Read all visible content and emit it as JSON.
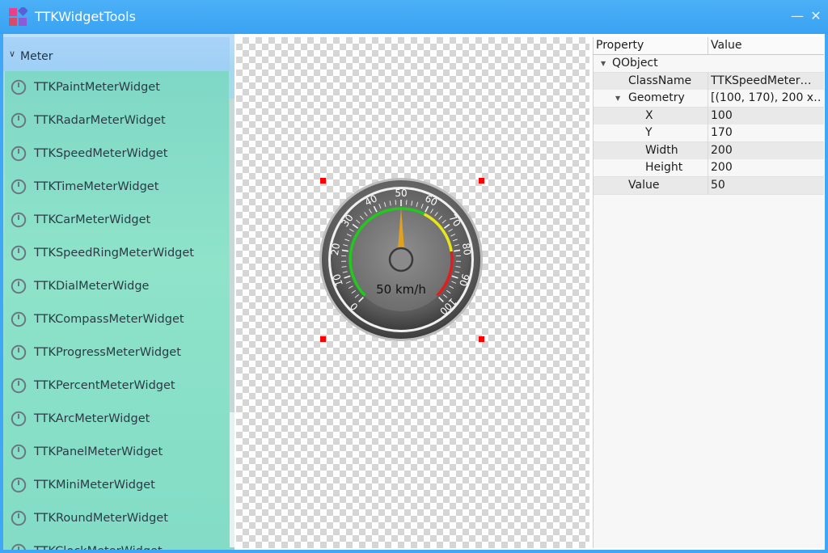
{
  "window": {
    "title": "TTKWidgetTools",
    "minimize_icon": "minimize-icon",
    "close_icon": "close-icon"
  },
  "sidebar": {
    "group_label": "Meter",
    "items": [
      "TTKPaintMeterWidget",
      "TTKRadarMeterWidget",
      "TTKSpeedMeterWidget",
      "TTKTimeMeterWidget",
      "TTKCarMeterWidget",
      "TTKSpeedRingMeterWidget",
      "TTKDialMeterWidge",
      "TTKCompassMeterWidget",
      "TTKProgressMeterWidget",
      "TTKPercentMeterWidget",
      "TTKArcMeterWidget",
      "TTKPanelMeterWidget",
      "TTKMiniMeterWidget",
      "TTKRoundMeterWidget",
      "TTKClockMeterWidget"
    ]
  },
  "gauge": {
    "value": 50,
    "unit_text": "50 km/h",
    "min": 0,
    "max": 100,
    "tick_labels": [
      "0",
      "10",
      "20",
      "30",
      "40",
      "50",
      "60",
      "70",
      "80",
      "90",
      "100"
    ],
    "colors": {
      "green": "#22c81e",
      "yellow": "#e6e61e",
      "red": "#e01e1e",
      "pointer": "#e0a020"
    }
  },
  "properties": {
    "header": {
      "property": "Property",
      "value": "Value"
    },
    "rows": [
      {
        "name": "QObject",
        "value": ""
      },
      {
        "name": "ClassName",
        "value": "TTKSpeedMeter…"
      },
      {
        "name": "Geometry",
        "value": "[(100, 170), 200 x…"
      },
      {
        "name": "X",
        "value": "100"
      },
      {
        "name": "Y",
        "value": "170"
      },
      {
        "name": "Width",
        "value": "200"
      },
      {
        "name": "Height",
        "value": "200"
      },
      {
        "name": "Value",
        "value": "50"
      }
    ]
  }
}
